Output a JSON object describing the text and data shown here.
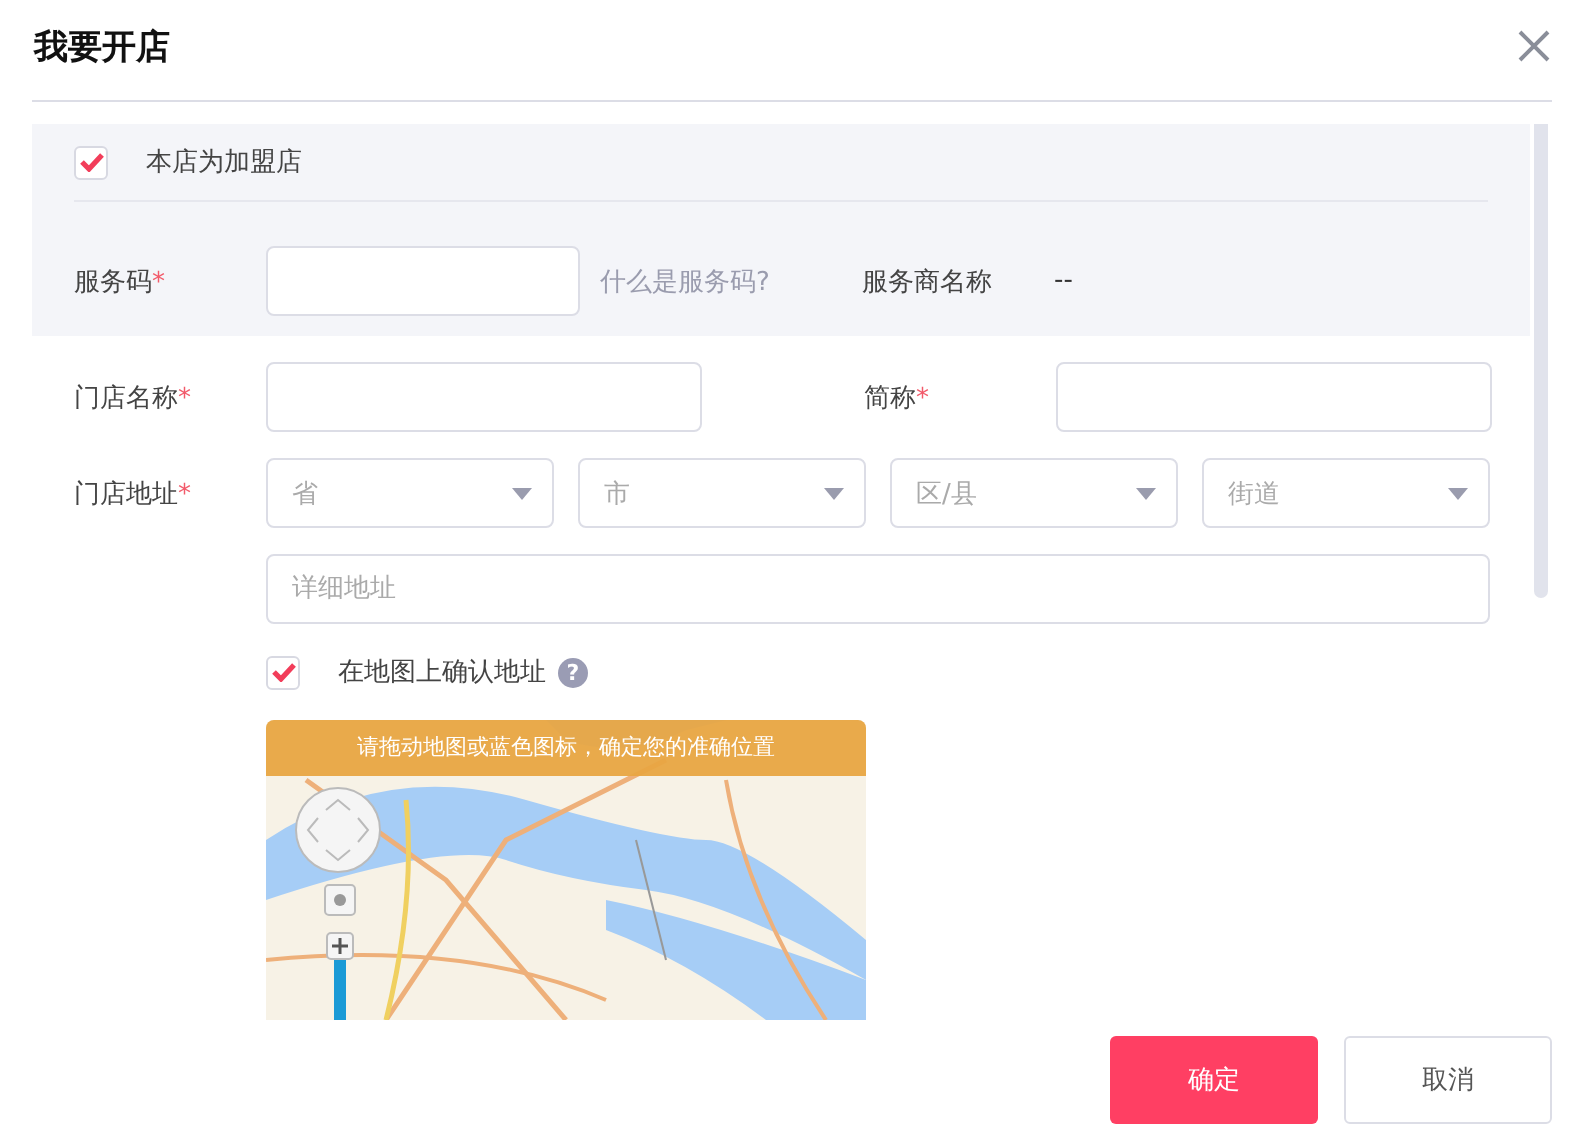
{
  "dialog": {
    "title": "我要开店"
  },
  "franchise": {
    "label": "本店为加盟店",
    "checked": true
  },
  "service_code": {
    "label": "服务码",
    "required_mark": "*",
    "help_link": "什么是服务码?",
    "provider_label": "服务商名称",
    "provider_value": "--"
  },
  "store_name": {
    "label": "门店名称",
    "required_mark": "*"
  },
  "short_name": {
    "label": "简称",
    "required_mark": "*"
  },
  "address": {
    "label": "门店地址",
    "required_mark": "*",
    "selects": [
      {
        "placeholder": "省"
      },
      {
        "placeholder": "市"
      },
      {
        "placeholder": "区/县"
      },
      {
        "placeholder": "街道"
      }
    ],
    "detail_placeholder": "详细地址"
  },
  "map_confirm": {
    "label": "在地图上确认地址",
    "checked": true,
    "help_icon": "?"
  },
  "map": {
    "banner": "请拖动地图或蓝色图标，确定您的准确位置"
  },
  "buttons": [
    {
      "label": "确定",
      "kind": "primary"
    },
    {
      "label": "取消",
      "kind": "default"
    }
  ]
}
